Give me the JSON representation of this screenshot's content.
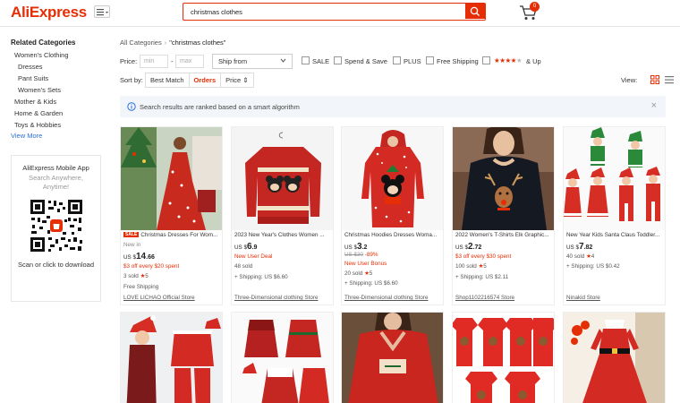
{
  "header": {
    "logo": "AliExpress",
    "search_value": "christmas clothes",
    "cart_count": "0"
  },
  "sidebar": {
    "title": "Related Categories",
    "items": [
      {
        "label": "Women's Clothing"
      },
      {
        "label": "Dresses"
      },
      {
        "label": "Pant Suits"
      },
      {
        "label": "Women's Sets"
      },
      {
        "label": "Mother & Kids"
      },
      {
        "label": "Home & Garden"
      },
      {
        "label": "Toys & Hobbies"
      }
    ],
    "view_more": "View More",
    "app": {
      "title": "AliExpress Mobile App",
      "subtitle_1": "Search Anywhere,",
      "subtitle_2": "Anytime!",
      "download": "Scan or click to download"
    }
  },
  "breadcrumb": {
    "root": "All Categories",
    "sep": "›",
    "current": "\"christmas clothes\""
  },
  "filters": {
    "price_label": "Price:",
    "min_placeholder": "min",
    "dash": "-",
    "max_placeholder": "max",
    "ship_from": "Ship from",
    "sale": "SALE",
    "spend_save": "Spend & Save",
    "plus": "PLUS",
    "free_shipping": "Free Shipping",
    "rating_filled": "★★★★",
    "rating_empty": "★",
    "rating_suffix": "& Up"
  },
  "sort": {
    "label": "Sort by:",
    "options": [
      "Best Match",
      "Orders",
      "Price"
    ],
    "price_arrow": "⇕",
    "view_label": "View:"
  },
  "notice": {
    "text": "Search results are ranked based on a smart algorithm",
    "close": "×"
  },
  "products": [
    {
      "tag": "SALE",
      "title": "Christmas Dresses For Wom...",
      "line2": "New in",
      "currency": "US $",
      "price_int": "14",
      "price_cents": ".66",
      "promo": "$3 off every $20 spent",
      "sold": "3 sold",
      "rating": "5",
      "shipping": "Free Shipping",
      "store": "LOVE LICHAO Official Store"
    },
    {
      "title": "2023 New Year's Clothes Women ...",
      "currency": "US $",
      "price_int": "6",
      "price_cents": ".9",
      "deal": "New User Deal",
      "sold": "48 sold",
      "shipping": "+ Shipping: US $6.60",
      "store": "Three-Dimensional clothing Store"
    },
    {
      "title": "Christmas Hoodies Dresses Woma...",
      "currency": "US $",
      "price_int": "3",
      "price_cents": ".2",
      "old_price": "US $30",
      "discount": "-89%",
      "deal": "New User Bonus",
      "sold": "20 sold",
      "rating": "5",
      "shipping": "+ Shipping: US $6.60",
      "store": "Three-Dimensional clothing Store"
    },
    {
      "title": "2022 Women's T-Shirts Elk Graphic...",
      "currency": "US $",
      "price_int": "2",
      "price_cents": ".72",
      "promo": "$3 off every $30 spent",
      "sold": "100 sold",
      "rating": "5",
      "shipping": "+ Shipping: US $2.11",
      "store": "Shop1102216574 Store"
    },
    {
      "title": "New Year Kids Santa Claus Toddler...",
      "currency": "US $",
      "price_int": "7",
      "price_cents": ".82",
      "sold": "40 sold",
      "rating": "4",
      "shipping": "+ Shipping: US $0.42",
      "store": "Ninakid Store"
    }
  ],
  "colors": {
    "accent": "#e62e04",
    "link": "#2a6fd6"
  }
}
